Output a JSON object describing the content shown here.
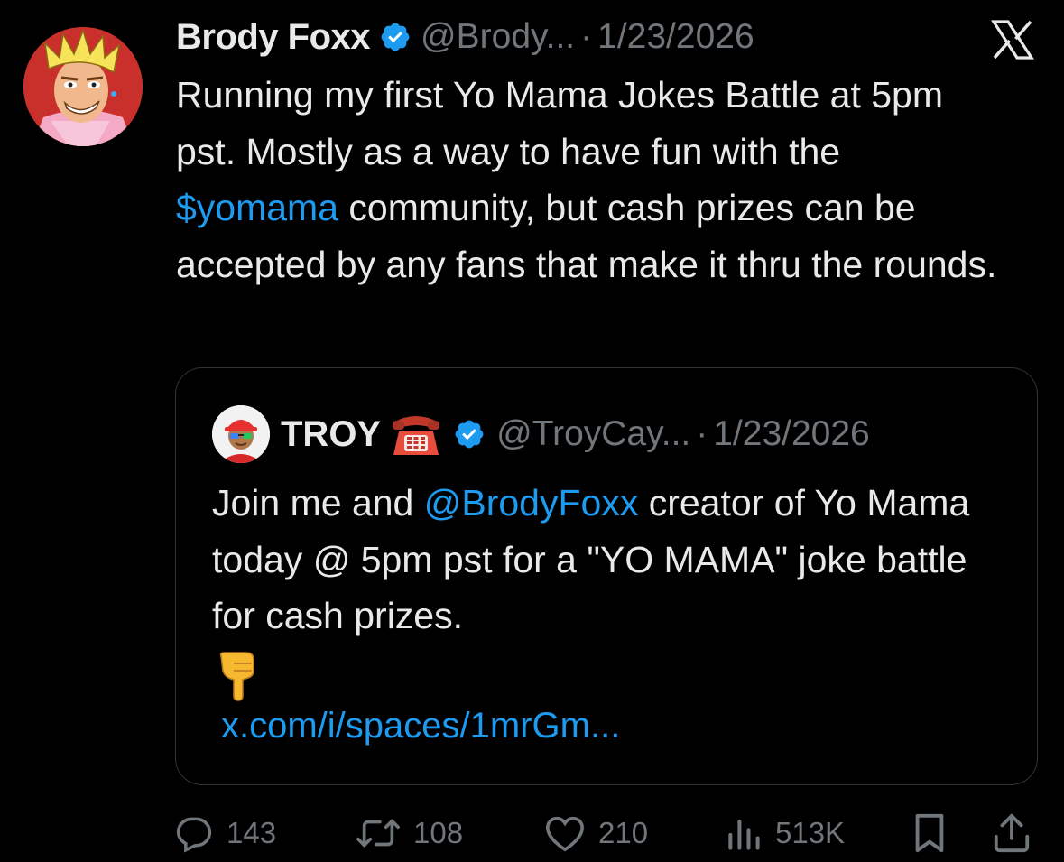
{
  "author": {
    "name": "Brody Foxx",
    "handle": "@Brody...",
    "date": "1/23/2026",
    "separator": "·"
  },
  "tweet": {
    "text_before": "Running my first Yo Mama Jokes Battle at 5pm pst. Mostly as a way to have fun with the ",
    "cashtag": "$yomama",
    "text_after": " community, but cash prizes can be accepted by any fans that make it thru the rounds."
  },
  "quote": {
    "name": "TROY",
    "handle": "@TroyCay...",
    "date": "1/23/2026",
    "separator": "·",
    "text_before": "Join me and ",
    "mention": "@BrodyFoxx",
    "text_after": " creator of Yo Mama today @ 5pm pst for a \"YO MAMA\" joke battle for cash prizes.",
    "url": "x.com/i/spaces/1mrGm..."
  },
  "actions": {
    "replies": "143",
    "reposts": "108",
    "likes": "210",
    "views": "513K"
  },
  "icons": [
    "verified-badge-icon",
    "x-logo-icon",
    "telephone-emoji-icon",
    "pointing-down-emoji-icon",
    "reply-icon",
    "repost-icon",
    "like-icon",
    "views-icon",
    "bookmark-icon",
    "share-icon"
  ],
  "colors": {
    "background": "#000000",
    "text": "#e7e9ea",
    "secondary": "#71767b",
    "link": "#1d9bf0",
    "border": "#2f3336"
  }
}
